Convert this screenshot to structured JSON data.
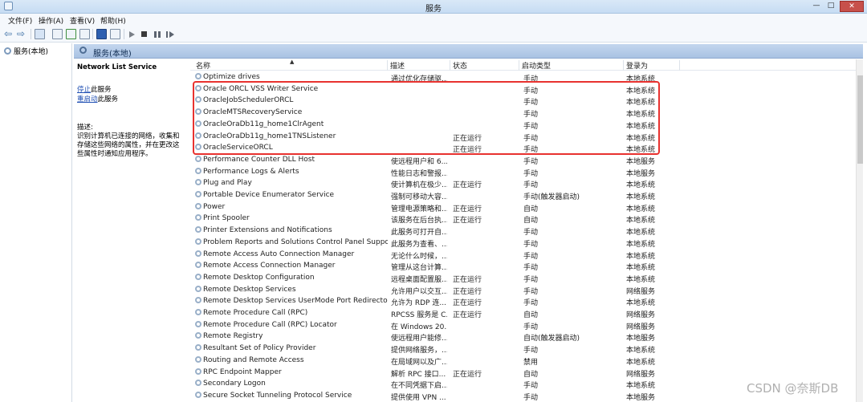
{
  "window": {
    "title": "服务",
    "min": "—",
    "max": "□",
    "close": "✕"
  },
  "menu": [
    "文件(F)",
    "操作(A)",
    "查看(V)",
    "帮助(H)"
  ],
  "tree": {
    "root": "服务(本地)"
  },
  "pane": {
    "title": "服务(本地)"
  },
  "details": {
    "service_name": "Network List Service",
    "stop_link": "停止",
    "stop_suffix": "此服务",
    "restart_link": "重启动",
    "restart_suffix": "此服务",
    "desc_label": "描述:",
    "desc_text": "识别计算机已连接的网络，收集和存储这些网络的属性，并在更改这些属性时通知应用程序。"
  },
  "columns": {
    "name": "名称",
    "desc": "描述",
    "status": "状态",
    "startup": "启动类型",
    "logon": "登录为"
  },
  "rows": [
    {
      "name": "Optimize drives",
      "desc": "通过优化存储驱...",
      "status": "",
      "startup": "手动",
      "logon": "本地系统"
    },
    {
      "name": "Oracle ORCL VSS Writer Service",
      "desc": "",
      "status": "",
      "startup": "手动",
      "logon": "本地系统"
    },
    {
      "name": "OracleJobSchedulerORCL",
      "desc": "",
      "status": "",
      "startup": "手动",
      "logon": "本地系统"
    },
    {
      "name": "OracleMTSRecoveryService",
      "desc": "",
      "status": "",
      "startup": "手动",
      "logon": "本地系统"
    },
    {
      "name": "OracleOraDb11g_home1ClrAgent",
      "desc": "",
      "status": "",
      "startup": "手动",
      "logon": "本地系统"
    },
    {
      "name": "OracleOraDb11g_home1TNSListener",
      "desc": "",
      "status": "正在运行",
      "startup": "手动",
      "logon": "本地系统"
    },
    {
      "name": "OracleServiceORCL",
      "desc": "",
      "status": "正在运行",
      "startup": "手动",
      "logon": "本地系统"
    },
    {
      "name": "Performance Counter DLL Host",
      "desc": "使远程用户和 6...",
      "status": "",
      "startup": "手动",
      "logon": "本地服务"
    },
    {
      "name": "Performance Logs & Alerts",
      "desc": "性能日志和警报...",
      "status": "",
      "startup": "手动",
      "logon": "本地服务"
    },
    {
      "name": "Plug and Play",
      "desc": "使计算机在极少...",
      "status": "正在运行",
      "startup": "手动",
      "logon": "本地系统"
    },
    {
      "name": "Portable Device Enumerator Service",
      "desc": "强制可移动大容...",
      "status": "",
      "startup": "手动(触发器启动)",
      "logon": "本地系统"
    },
    {
      "name": "Power",
      "desc": "管理电源策略和...",
      "status": "正在运行",
      "startup": "自动",
      "logon": "本地系统"
    },
    {
      "name": "Print Spooler",
      "desc": "该服务在后台执...",
      "status": "正在运行",
      "startup": "自动",
      "logon": "本地系统"
    },
    {
      "name": "Printer Extensions and Notifications",
      "desc": "此服务可打开自...",
      "status": "",
      "startup": "手动",
      "logon": "本地系统"
    },
    {
      "name": "Problem Reports and Solutions Control Panel Support",
      "desc": "此服务为查看、...",
      "status": "",
      "startup": "手动",
      "logon": "本地系统"
    },
    {
      "name": "Remote Access Auto Connection Manager",
      "desc": "无论什么时候，...",
      "status": "",
      "startup": "手动",
      "logon": "本地系统"
    },
    {
      "name": "Remote Access Connection Manager",
      "desc": "管理从这台计算...",
      "status": "",
      "startup": "手动",
      "logon": "本地系统"
    },
    {
      "name": "Remote Desktop Configuration",
      "desc": "远程桌面配置服...",
      "status": "正在运行",
      "startup": "手动",
      "logon": "本地系统"
    },
    {
      "name": "Remote Desktop Services",
      "desc": "允许用户以交互...",
      "status": "正在运行",
      "startup": "手动",
      "logon": "网络服务"
    },
    {
      "name": "Remote Desktop Services UserMode Port Redirector",
      "desc": "允许为 RDP 连...",
      "status": "正在运行",
      "startup": "手动",
      "logon": "本地系统"
    },
    {
      "name": "Remote Procedure Call (RPC)",
      "desc": "RPCSS 服务是 C...",
      "status": "正在运行",
      "startup": "自动",
      "logon": "网络服务"
    },
    {
      "name": "Remote Procedure Call (RPC) Locator",
      "desc": "在 Windows 20...",
      "status": "",
      "startup": "手动",
      "logon": "网络服务"
    },
    {
      "name": "Remote Registry",
      "desc": "使远程用户能修...",
      "status": "",
      "startup": "自动(触发器启动)",
      "logon": "本地服务"
    },
    {
      "name": "Resultant Set of Policy Provider",
      "desc": "提供网络服务，...",
      "status": "",
      "startup": "手动",
      "logon": "本地系统"
    },
    {
      "name": "Routing and Remote Access",
      "desc": "在局域网以及广...",
      "status": "",
      "startup": "禁用",
      "logon": "本地系统"
    },
    {
      "name": "RPC Endpoint Mapper",
      "desc": "解析 RPC 接口...",
      "status": "正在运行",
      "startup": "自动",
      "logon": "网络服务"
    },
    {
      "name": "Secondary Logon",
      "desc": "在不同凭据下启...",
      "status": "",
      "startup": "手动",
      "logon": "本地系统"
    },
    {
      "name": "Secure Socket Tunneling Protocol Service",
      "desc": "提供使用 VPN ...",
      "status": "",
      "startup": "手动",
      "logon": "本地服务"
    }
  ],
  "watermark": "CSDN @奈斯DB"
}
